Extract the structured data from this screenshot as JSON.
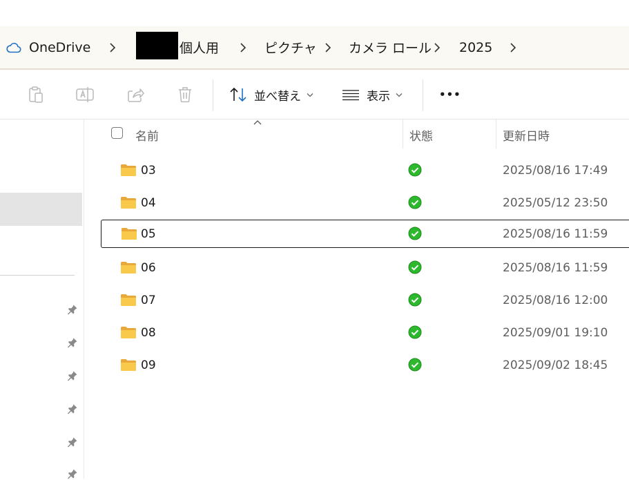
{
  "breadcrumb": {
    "items": [
      {
        "label": "OneDrive"
      },
      {
        "label": "個人用"
      },
      {
        "label": "ピクチャ"
      },
      {
        "label": "カメラ ロール"
      },
      {
        "label": "2025"
      }
    ]
  },
  "toolbar": {
    "sort_label": "並べ替え",
    "view_label": "表示",
    "more_label": "•••"
  },
  "list": {
    "columns": {
      "name": "名前",
      "status": "状態",
      "modified": "更新日時"
    },
    "rows": [
      {
        "name": "03",
        "modified": "2025/08/16 17:49",
        "status": "synced"
      },
      {
        "name": "04",
        "modified": "2025/05/12 23:50",
        "status": "synced"
      },
      {
        "name": "05",
        "modified": "2025/08/16 11:59",
        "status": "synced"
      },
      {
        "name": "06",
        "modified": "2025/08/16 11:59",
        "status": "synced"
      },
      {
        "name": "07",
        "modified": "2025/08/16 12:00",
        "status": "synced"
      },
      {
        "name": "08",
        "modified": "2025/09/01 19:10",
        "status": "synced"
      },
      {
        "name": "09",
        "modified": "2025/09/02 18:45",
        "status": "synced"
      }
    ]
  },
  "colors": {
    "accent": "#1f6fc5",
    "synced": "#2eb82e",
    "folder": "#f8c94a"
  }
}
